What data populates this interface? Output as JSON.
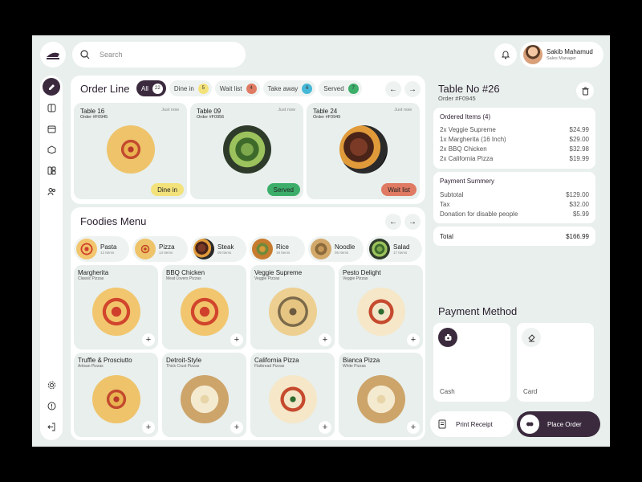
{
  "search": {
    "placeholder": "Search"
  },
  "user": {
    "name": "Sakib Mahamud",
    "role": "Sales Manager"
  },
  "order_line": {
    "title": "Order Line",
    "filters": [
      {
        "label": "All",
        "count": "22",
        "color": "#ffffff"
      },
      {
        "label": "Dine in",
        "count": "5",
        "color": "#f3e27a"
      },
      {
        "label": "Wait list",
        "count": "4",
        "color": "#e07a62"
      },
      {
        "label": "Take away",
        "count": "6",
        "color": "#45b8d8"
      },
      {
        "label": "Served",
        "count": "7",
        "color": "#3cae6a"
      }
    ],
    "orders": [
      {
        "table": "Table 16",
        "order": "Order #F0945",
        "time": "Just now",
        "status": "Dine in",
        "status_color": "#f3e27a"
      },
      {
        "table": "Table 09",
        "order": "Order #F0956",
        "time": "Just now",
        "status": "Served",
        "status_color": "#3cae6a"
      },
      {
        "table": "Table 24",
        "order": "Order #F0949",
        "time": "Just now",
        "status": "Wait list",
        "status_color": "#e07a62"
      }
    ]
  },
  "foodies": {
    "title": "Foodies Menu",
    "categories": [
      {
        "name": "Pasta",
        "items": "12 Items"
      },
      {
        "name": "Pizza",
        "items": "14 Items"
      },
      {
        "name": "Steak",
        "items": "09 Items"
      },
      {
        "name": "Rice",
        "items": "19 Items"
      },
      {
        "name": "Noodle",
        "items": "05 Items"
      },
      {
        "name": "Salad",
        "items": "17 Items"
      }
    ],
    "menu": [
      {
        "name": "Margherita",
        "sub": "Classic Pizzas"
      },
      {
        "name": "BBQ Chicken",
        "sub": "Meat Lovers Pizzas"
      },
      {
        "name": "Veggie Supreme",
        "sub": "Veggie Pizzas"
      },
      {
        "name": "Pesto Delight",
        "sub": "Veggie Pizzas"
      },
      {
        "name": "Truffle & Prosciutto",
        "sub": "Artisan Pizzas"
      },
      {
        "name": "Detroit-Style",
        "sub": "Thick Crust Pizzas"
      },
      {
        "name": "California Pizza",
        "sub": "Flatbread Pizzas"
      },
      {
        "name": "Bianca Pizza",
        "sub": "White Pizzas"
      }
    ],
    "add_label": "+"
  },
  "table": {
    "title": "Table No #26",
    "order": "Order #F0945",
    "ordered_title": "Ordered Items (4)",
    "items": [
      {
        "qty": "2x",
        "name": "Veggie Supreme",
        "price": "$24.99"
      },
      {
        "qty": "1x",
        "name": "Margherita (16 Inch)",
        "price": "$29.00"
      },
      {
        "qty": "2x",
        "name": "BBQ Chicken",
        "price": "$32.98"
      },
      {
        "qty": "2x",
        "name": "California Pizza",
        "price": "$19.99"
      }
    ],
    "summary_title": "Payment Summery",
    "summary": [
      {
        "label": "Subtotal",
        "value": "$129.00"
      },
      {
        "label": "Tax",
        "value": "$32.00"
      },
      {
        "label": "Donation for disable people",
        "value": "$5.99"
      }
    ],
    "total_label": "Total",
    "total_value": "$166.99"
  },
  "payment": {
    "title": "Payment Method",
    "methods": [
      {
        "label": "Cash"
      },
      {
        "label": "Card"
      }
    ]
  },
  "actions": {
    "print": "Print Receipt",
    "place": "Place Order"
  },
  "colors": {
    "accent": "#3b2a3e",
    "background": "#e8efec"
  }
}
